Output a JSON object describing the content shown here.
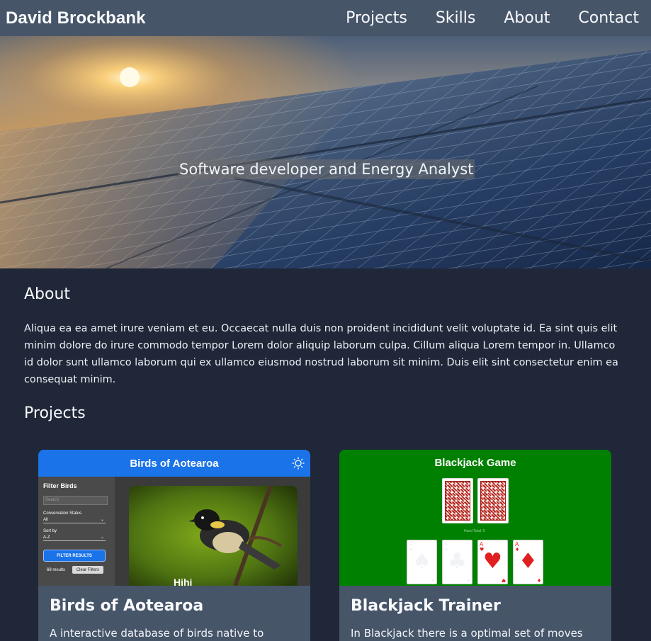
{
  "nav": {
    "brand": "David Brockbank",
    "links": [
      "Projects",
      "Skills",
      "About",
      "Contact"
    ]
  },
  "hero": {
    "tagline": "Software developer and Energy Analyst"
  },
  "about": {
    "heading": "About",
    "text": "Aliqua ea ea amet irure veniam et eu. Occaecat nulla duis non proident incididunt velit voluptate id. Ea sint quis elit minim dolore do irure commodo tempor Lorem dolor aliquip laborum culpa. Cillum aliqua Lorem tempor in. Ullamco id dolor sunt ullamco laborum qui ex ullamco eiusmod nostrud laborum sit minim. Duis elit sint consectetur enim ea consequat minim."
  },
  "projects": {
    "heading": "Projects",
    "cards": [
      {
        "title": "Birds of Aotearoa",
        "description": "A interactive database of birds native to",
        "thumbnail": {
          "app_title": "Birds of Aotearoa",
          "sidebar_title": "Filter Birds",
          "search_placeholder": "Search",
          "conservation_label": "Conservation Status",
          "conservation_value": "All",
          "sort_label": "Sort by",
          "sort_value": "A-Z",
          "filter_button": "FILTER RESULTS",
          "results_count": "68 results",
          "clear_button": "Clear Filters",
          "bird_name": "Hihi"
        }
      },
      {
        "title": "Blackjack Trainer",
        "description": "In Blackjack there is a optimal set of moves",
        "thumbnail": {
          "app_title": "Blackjack Game",
          "dealer_text": "Hand Total: 0",
          "cards": [
            {
              "rank": "A",
              "suit": "♠",
              "color": "#000000"
            },
            {
              "rank": "A",
              "suit": "♣",
              "color": "#000000"
            },
            {
              "rank": "A",
              "suit": "♥",
              "color": "#e02020"
            },
            {
              "rank": "A",
              "suit": "♦",
              "color": "#e02020"
            }
          ]
        }
      }
    ]
  },
  "colors": {
    "page_bg": "#1f2738",
    "nav_bg": "#475569",
    "card_bg": "#475569",
    "birds_header": "#1a73e8",
    "blackjack_felt": "#008000"
  }
}
